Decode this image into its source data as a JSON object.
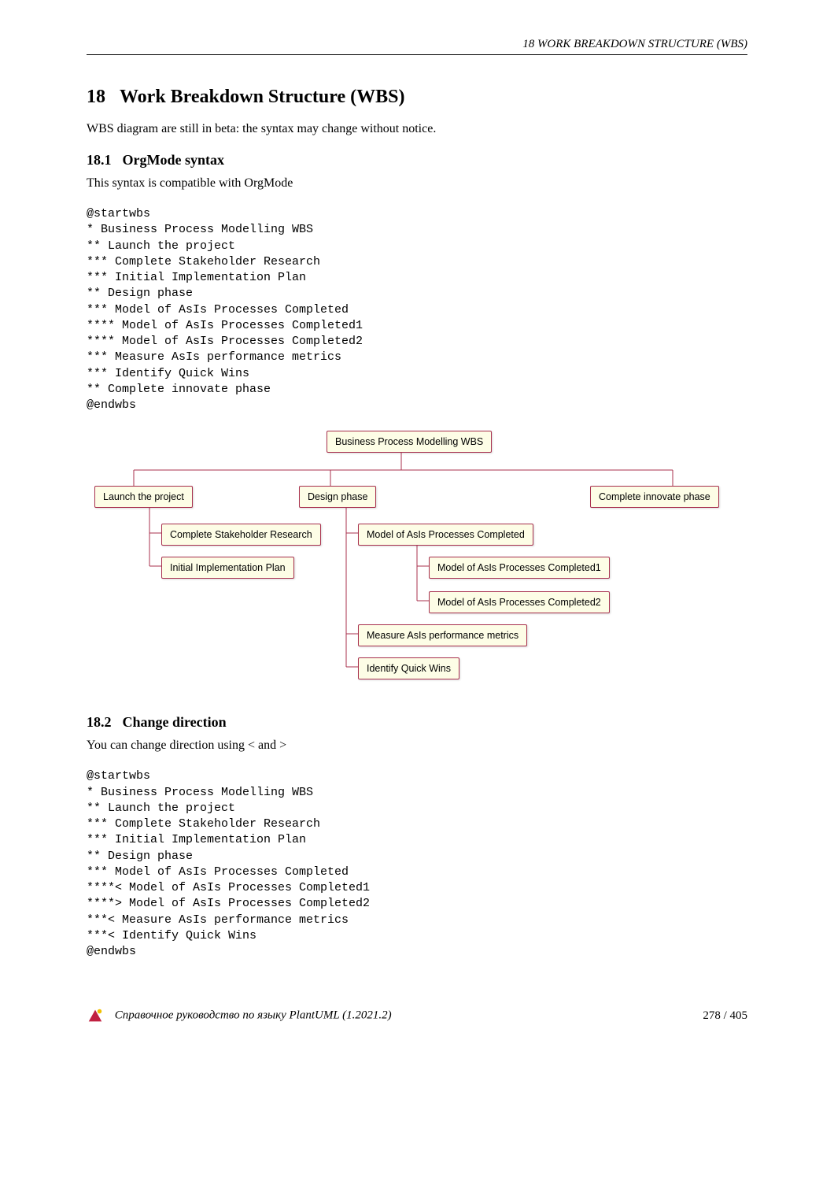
{
  "header": {
    "running": "18   WORK BREAKDOWN STRUCTURE (WBS)"
  },
  "section": {
    "num": "18",
    "title": "Work Breakdown Structure (WBS)",
    "intro": "WBS diagram are still in beta: the syntax may change without notice."
  },
  "sub1": {
    "num": "18.1",
    "title": "OrgMode syntax",
    "intro": "This syntax is compatible with OrgMode",
    "code": "@startwbs\n* Business Process Modelling WBS\n** Launch the project\n*** Complete Stakeholder Research\n*** Initial Implementation Plan\n** Design phase\n*** Model of AsIs Processes Completed\n**** Model of AsIs Processes Completed1\n**** Model of AsIs Processes Completed2\n*** Measure AsIs performance metrics\n*** Identify Quick Wins\n** Complete innovate phase\n@endwbs"
  },
  "wbs": {
    "root": "Business Process Modelling WBS",
    "n_launch": "Launch the project",
    "n_design": "Design phase",
    "n_complete": "Complete innovate phase",
    "n_stake": "Complete Stakeholder Research",
    "n_impl": "Initial Implementation Plan",
    "n_model": "Model of AsIs Processes Completed",
    "n_model1": "Model of AsIs Processes Completed1",
    "n_model2": "Model of AsIs Processes Completed2",
    "n_measure": "Measure AsIs performance metrics",
    "n_wins": "Identify Quick Wins"
  },
  "sub2": {
    "num": "18.2",
    "title": "Change direction",
    "intro": "You can change direction using < and >",
    "code": "@startwbs\n* Business Process Modelling WBS\n** Launch the project\n*** Complete Stakeholder Research\n*** Initial Implementation Plan\n** Design phase\n*** Model of AsIs Processes Completed\n****< Model of AsIs Processes Completed1\n****> Model of AsIs Processes Completed2\n***< Measure AsIs performance metrics\n***< Identify Quick Wins\n@endwbs"
  },
  "footer": {
    "ref": "Справочное руководство по языку PlantUML (1.2021.2)",
    "page": "278 / 405"
  }
}
